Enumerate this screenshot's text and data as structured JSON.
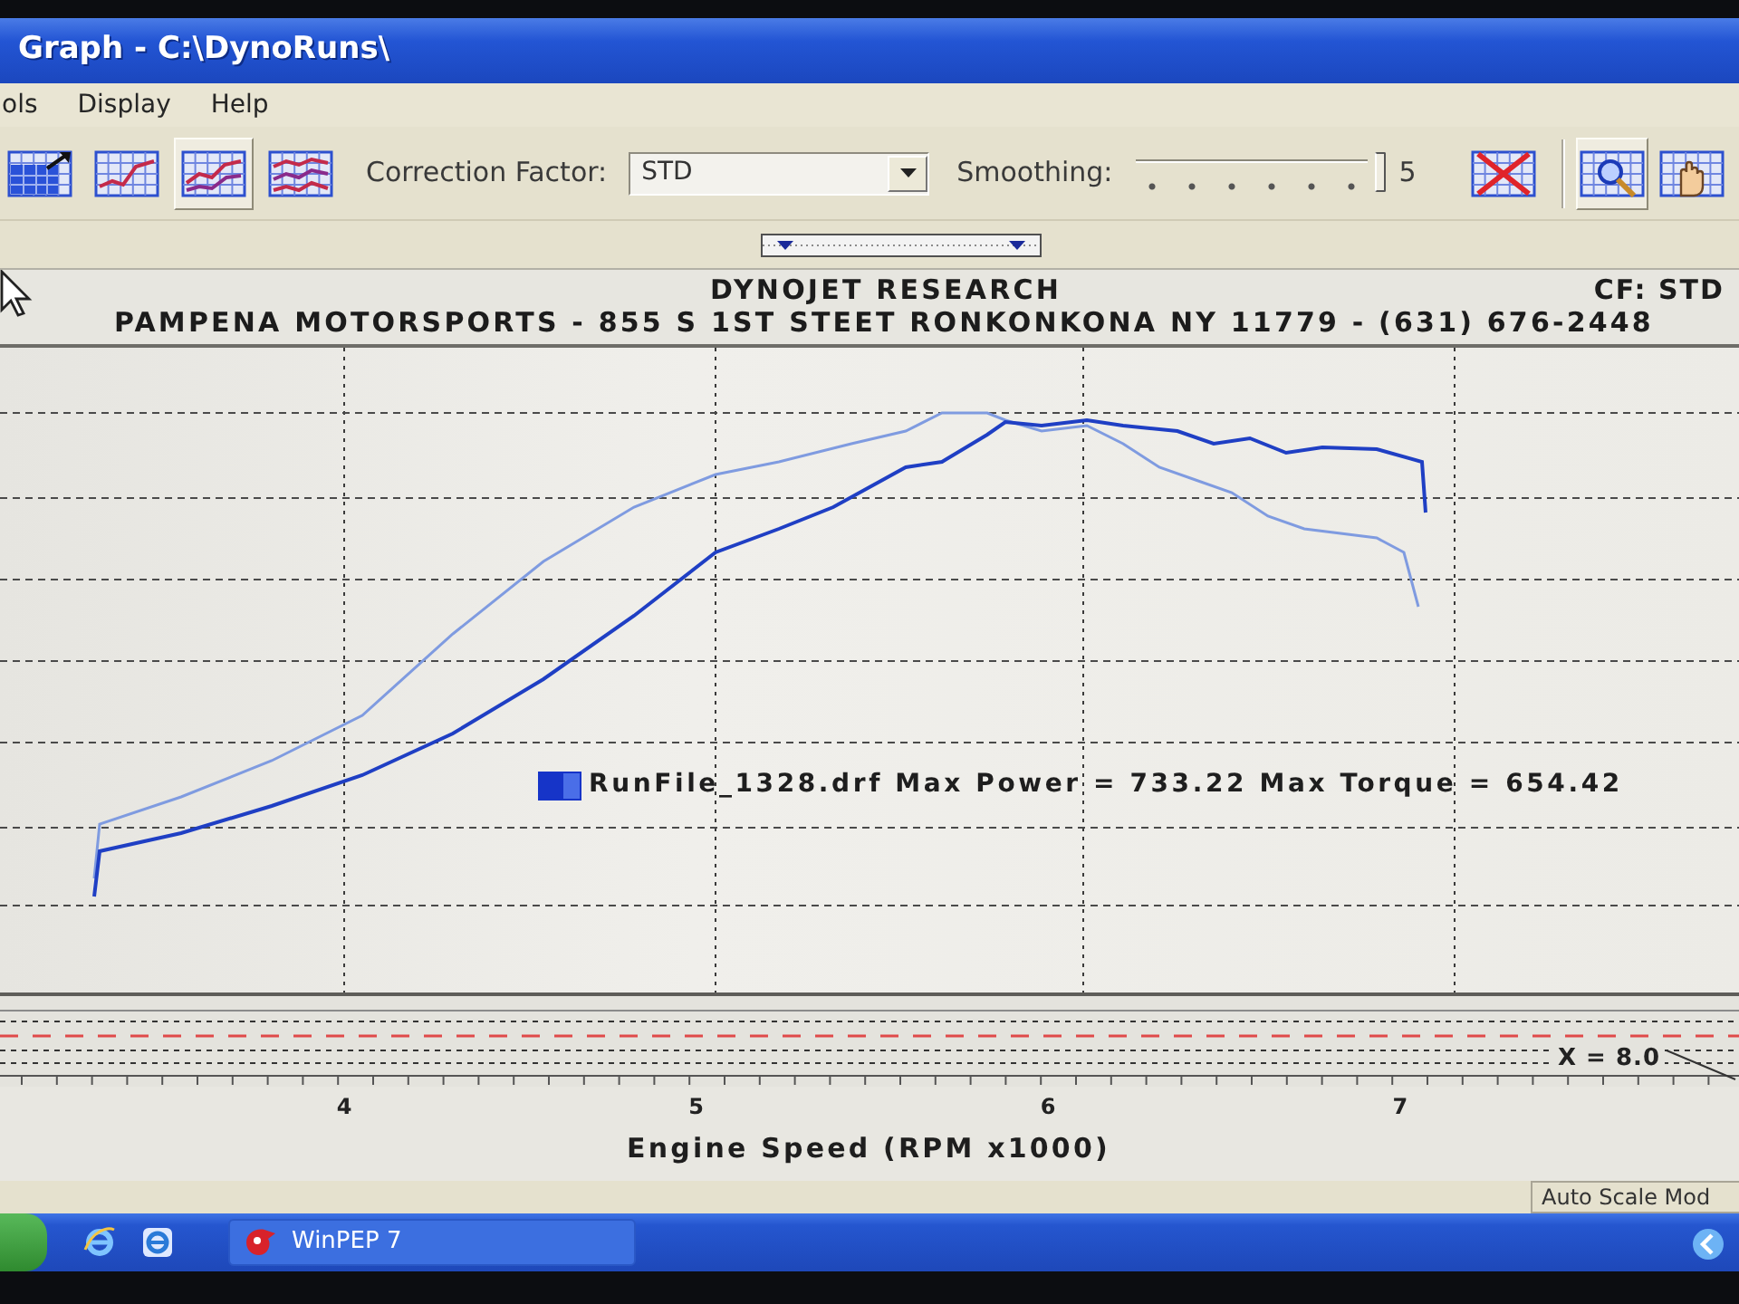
{
  "window": {
    "title": "Graph - C:\\DynoRuns\\"
  },
  "menu": [
    {
      "label": "ols"
    },
    {
      "label": "Display"
    },
    {
      "label": "Help"
    }
  ],
  "toolbar": {
    "view_buttons": [
      {
        "selected": false
      },
      {
        "selected": false
      },
      {
        "selected": true
      },
      {
        "selected": false
      }
    ],
    "correction_factor": {
      "label": "Correction Factor:",
      "value": "STD"
    },
    "smoothing": {
      "label": "Smoothing:",
      "level": 1,
      "reading": "5"
    },
    "tool_buttons": [
      {
        "selected": false
      },
      {
        "selected": true
      },
      {
        "selected": false
      }
    ]
  },
  "header": {
    "title": "DYNOJET RESEARCH",
    "address": "PAMPENA MOTORSPORTS - 855 S 1ST STEET RONKONKONA NY 11779 - (631) 676-2448",
    "correction": "CF: STD"
  },
  "graph": {
    "legend": "RunFile_1328.drf Max Power = 733.22 Max Torque = 654.42"
  },
  "overview": {
    "readout": "X = 8.0"
  },
  "x_axis": {
    "ticks": [
      "4",
      "5",
      "6",
      "7"
    ],
    "title": "Engine Speed (RPM x1000)"
  },
  "status_bar": {
    "mode": "Auto Scale Mod"
  },
  "taskbar": {
    "tasks": [
      {
        "label": "WinPEP 7"
      }
    ]
  }
}
